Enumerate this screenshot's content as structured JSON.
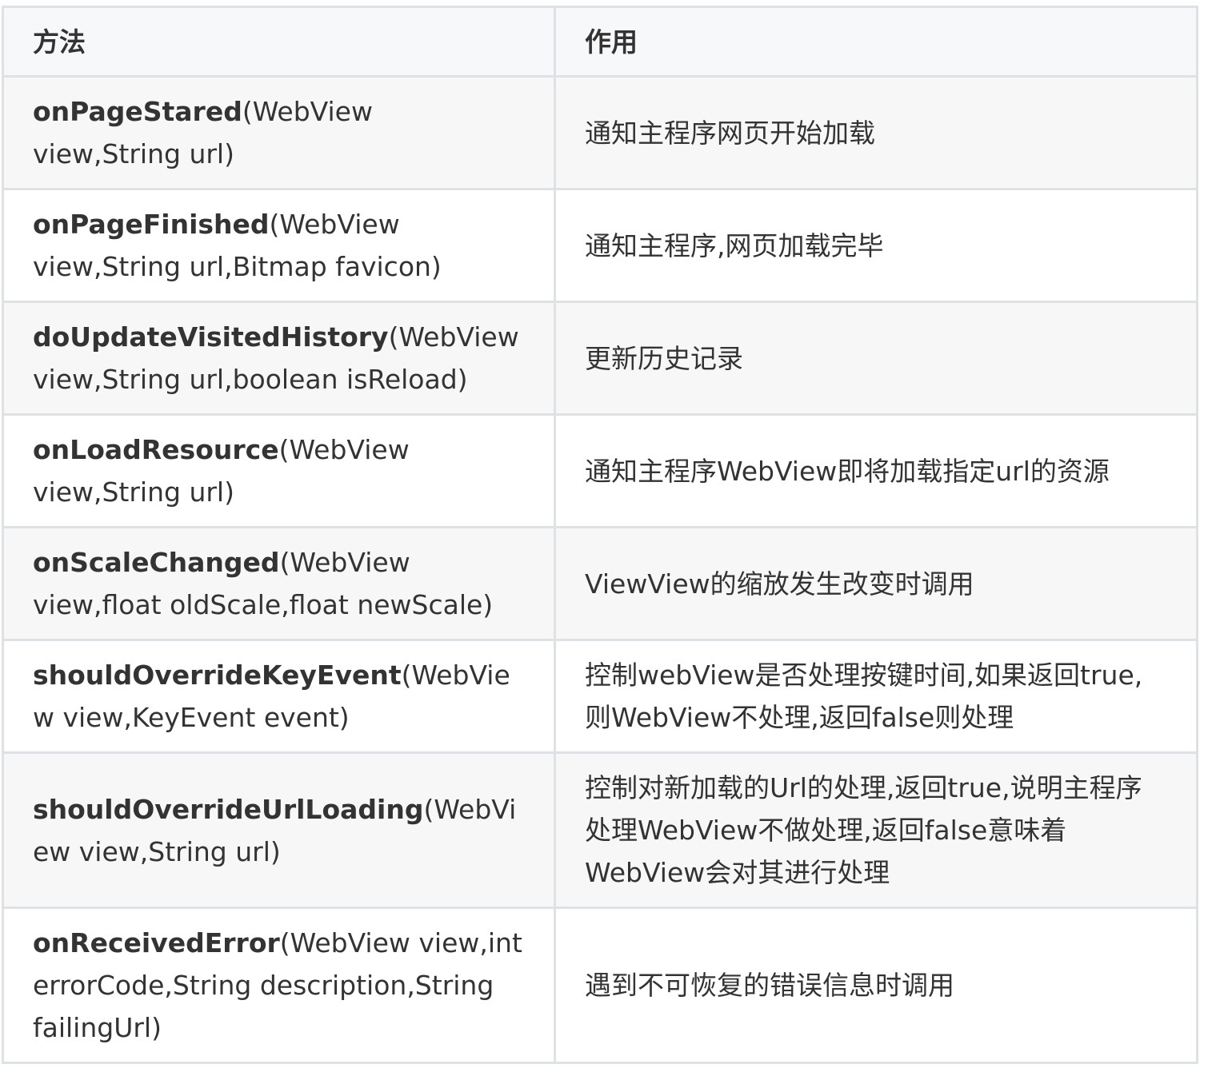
{
  "table": {
    "headers": [
      "方法",
      "作用"
    ],
    "rows": [
      {
        "name": "onPageStared",
        "params": "(WebView view,String url)",
        "desc": "通知主程序网页开始加载"
      },
      {
        "name": "onPageFinished",
        "params": "(WebView view,String url,Bitmap favicon)",
        "desc": "通知主程序,网页加载完毕"
      },
      {
        "name": "doUpdateVisitedHistory",
        "params": "(WebView view,String url,boolean isReload)",
        "desc": "更新历史记录"
      },
      {
        "name": "onLoadResource",
        "params": "(WebView view,String url)",
        "desc": "通知主程序WebView即将加载指定url的资源"
      },
      {
        "name": "onScaleChanged",
        "params": "(WebView view,float oldScale,float newScale)",
        "desc": "ViewView的缩放发生改变时调用"
      },
      {
        "name": "shouldOverrideKeyEvent",
        "params": "(WebView view,KeyEvent event)",
        "desc": "控制webView是否处理按键时间,如果返回true,则WebView不处理,返回false则处理"
      },
      {
        "name": "shouldOverrideUrlLoading",
        "params": "(WebView view,String url)",
        "desc": "控制对新加载的Url的处理,返回true,说明主程序处理WebView不做处理,返回false意味着WebView会对其进行处理"
      },
      {
        "name": "onReceivedError",
        "params": "(WebView view,int errorCode,String description,String failingUrl)",
        "desc": "遇到不可恢复的错误信息时调用"
      }
    ]
  }
}
